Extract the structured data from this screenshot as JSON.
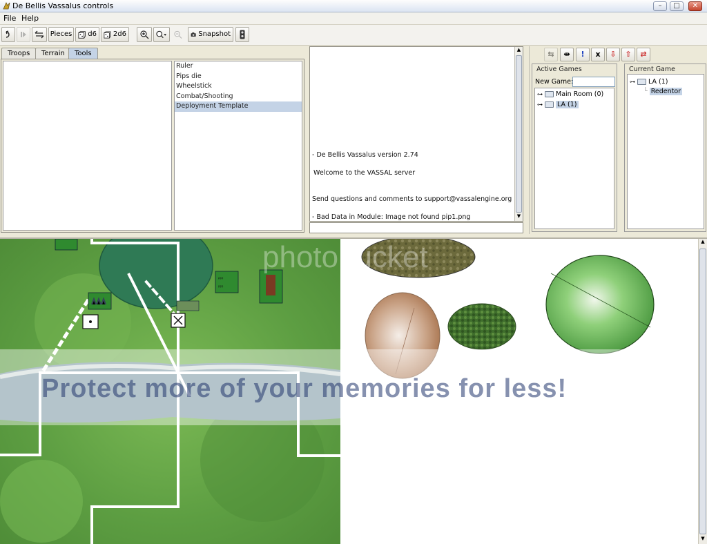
{
  "window": {
    "title": "De Bellis Vassalus controls"
  },
  "menu": {
    "file": "File",
    "help": "Help"
  },
  "toolbar": {
    "pieces": "Pieces",
    "d6": "d6",
    "twod6": "2d6",
    "snapshot": "Snapshot"
  },
  "tabs": [
    "Troops",
    "Terrain",
    "Tools"
  ],
  "tools": [
    "Ruler",
    "Pips die",
    "Wheelstick",
    "Combat/Shooting",
    "Deployment Template"
  ],
  "chat": {
    "lines": [
      "- De Bellis Vassalus version 2.74",
      "Welcome to the VASSAL server",
      "Send questions and comments to support@vassalengine.org",
      "- Bad Data in Module: Image not found pip1.png"
    ]
  },
  "server": {
    "active_games_title": "Active Games",
    "new_game_label": "New Game:",
    "rooms": [
      "Main Room (0)",
      "LA (1)"
    ],
    "current_game_title": "Current Game",
    "current_room": "LA (1)",
    "player": "Redentor"
  },
  "watermark": {
    "text": "Protect more of your memories for less!",
    "brand": "photobucket"
  },
  "colors": {
    "selection": "#c4d3e6",
    "grass": "#6fae4a",
    "road": "#ffffff"
  }
}
